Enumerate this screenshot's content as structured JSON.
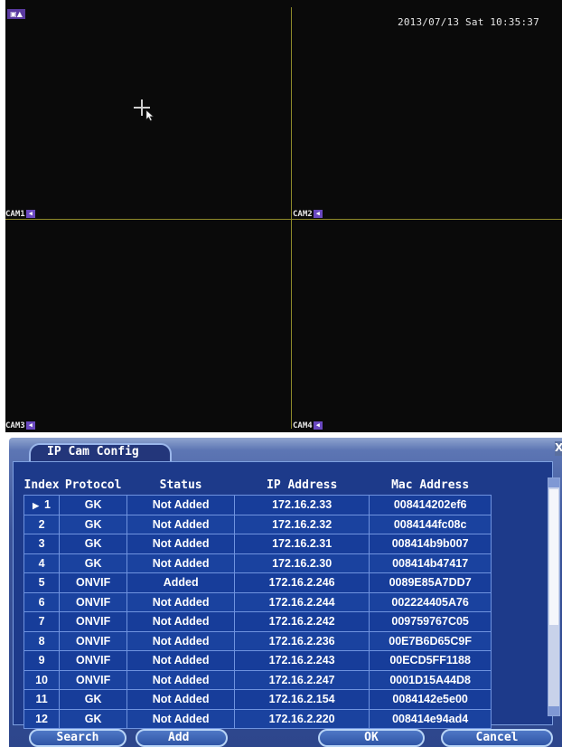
{
  "monitor": {
    "datetime": "2013/07/13 Sat 10:35:37",
    "cams": [
      {
        "label": "CAM1"
      },
      {
        "label": "CAM2"
      },
      {
        "label": "CAM3"
      },
      {
        "label": "CAM4"
      }
    ]
  },
  "dialog": {
    "title": "IP Cam Config",
    "columns": [
      "Index",
      "Protocol",
      "Status",
      "IP Address",
      "Mac Address"
    ],
    "rows": [
      {
        "index": "1",
        "protocol": "GK",
        "status": "Not Added",
        "ip": "172.16.2.33",
        "mac": "008414202ef6"
      },
      {
        "index": "2",
        "protocol": "GK",
        "status": "Not Added",
        "ip": "172.16.2.32",
        "mac": "0084144fc08c"
      },
      {
        "index": "3",
        "protocol": "GK",
        "status": "Not Added",
        "ip": "172.16.2.31",
        "mac": "008414b9b007"
      },
      {
        "index": "4",
        "protocol": "GK",
        "status": "Not Added",
        "ip": "172.16.2.30",
        "mac": "008414b47417"
      },
      {
        "index": "5",
        "protocol": "ONVIF",
        "status": "Added",
        "ip": "172.16.2.246",
        "mac": "0089E85A7DD7"
      },
      {
        "index": "6",
        "protocol": "ONVIF",
        "status": "Not Added",
        "ip": "172.16.2.244",
        "mac": "002224405A76"
      },
      {
        "index": "7",
        "protocol": "ONVIF",
        "status": "Not Added",
        "ip": "172.16.2.242",
        "mac": "009759767C05"
      },
      {
        "index": "8",
        "protocol": "ONVIF",
        "status": "Not Added",
        "ip": "172.16.2.236",
        "mac": "00E7B6D65C9F"
      },
      {
        "index": "9",
        "protocol": "ONVIF",
        "status": "Not Added",
        "ip": "172.16.2.243",
        "mac": "00ECD5FF1188"
      },
      {
        "index": "10",
        "protocol": "ONVIF",
        "status": "Not Added",
        "ip": "172.16.2.247",
        "mac": "0001D15A44D8"
      },
      {
        "index": "11",
        "protocol": "GK",
        "status": "Not Added",
        "ip": "172.16.2.154",
        "mac": "0084142e5e00"
      },
      {
        "index": "12",
        "protocol": "GK",
        "status": "Not Added",
        "ip": "172.16.2.220",
        "mac": "008414e94ad4"
      }
    ],
    "selected_row_marker": "▶",
    "buttons": {
      "search": "Search",
      "add": "Add",
      "ok": "OK",
      "cancel": "Cancel"
    },
    "close_glyph": "X"
  },
  "colors": {
    "panel": "#2d468c",
    "cell": "#173d9a",
    "grid_line": "#6f93df",
    "split_line": "#8f8a2a"
  }
}
